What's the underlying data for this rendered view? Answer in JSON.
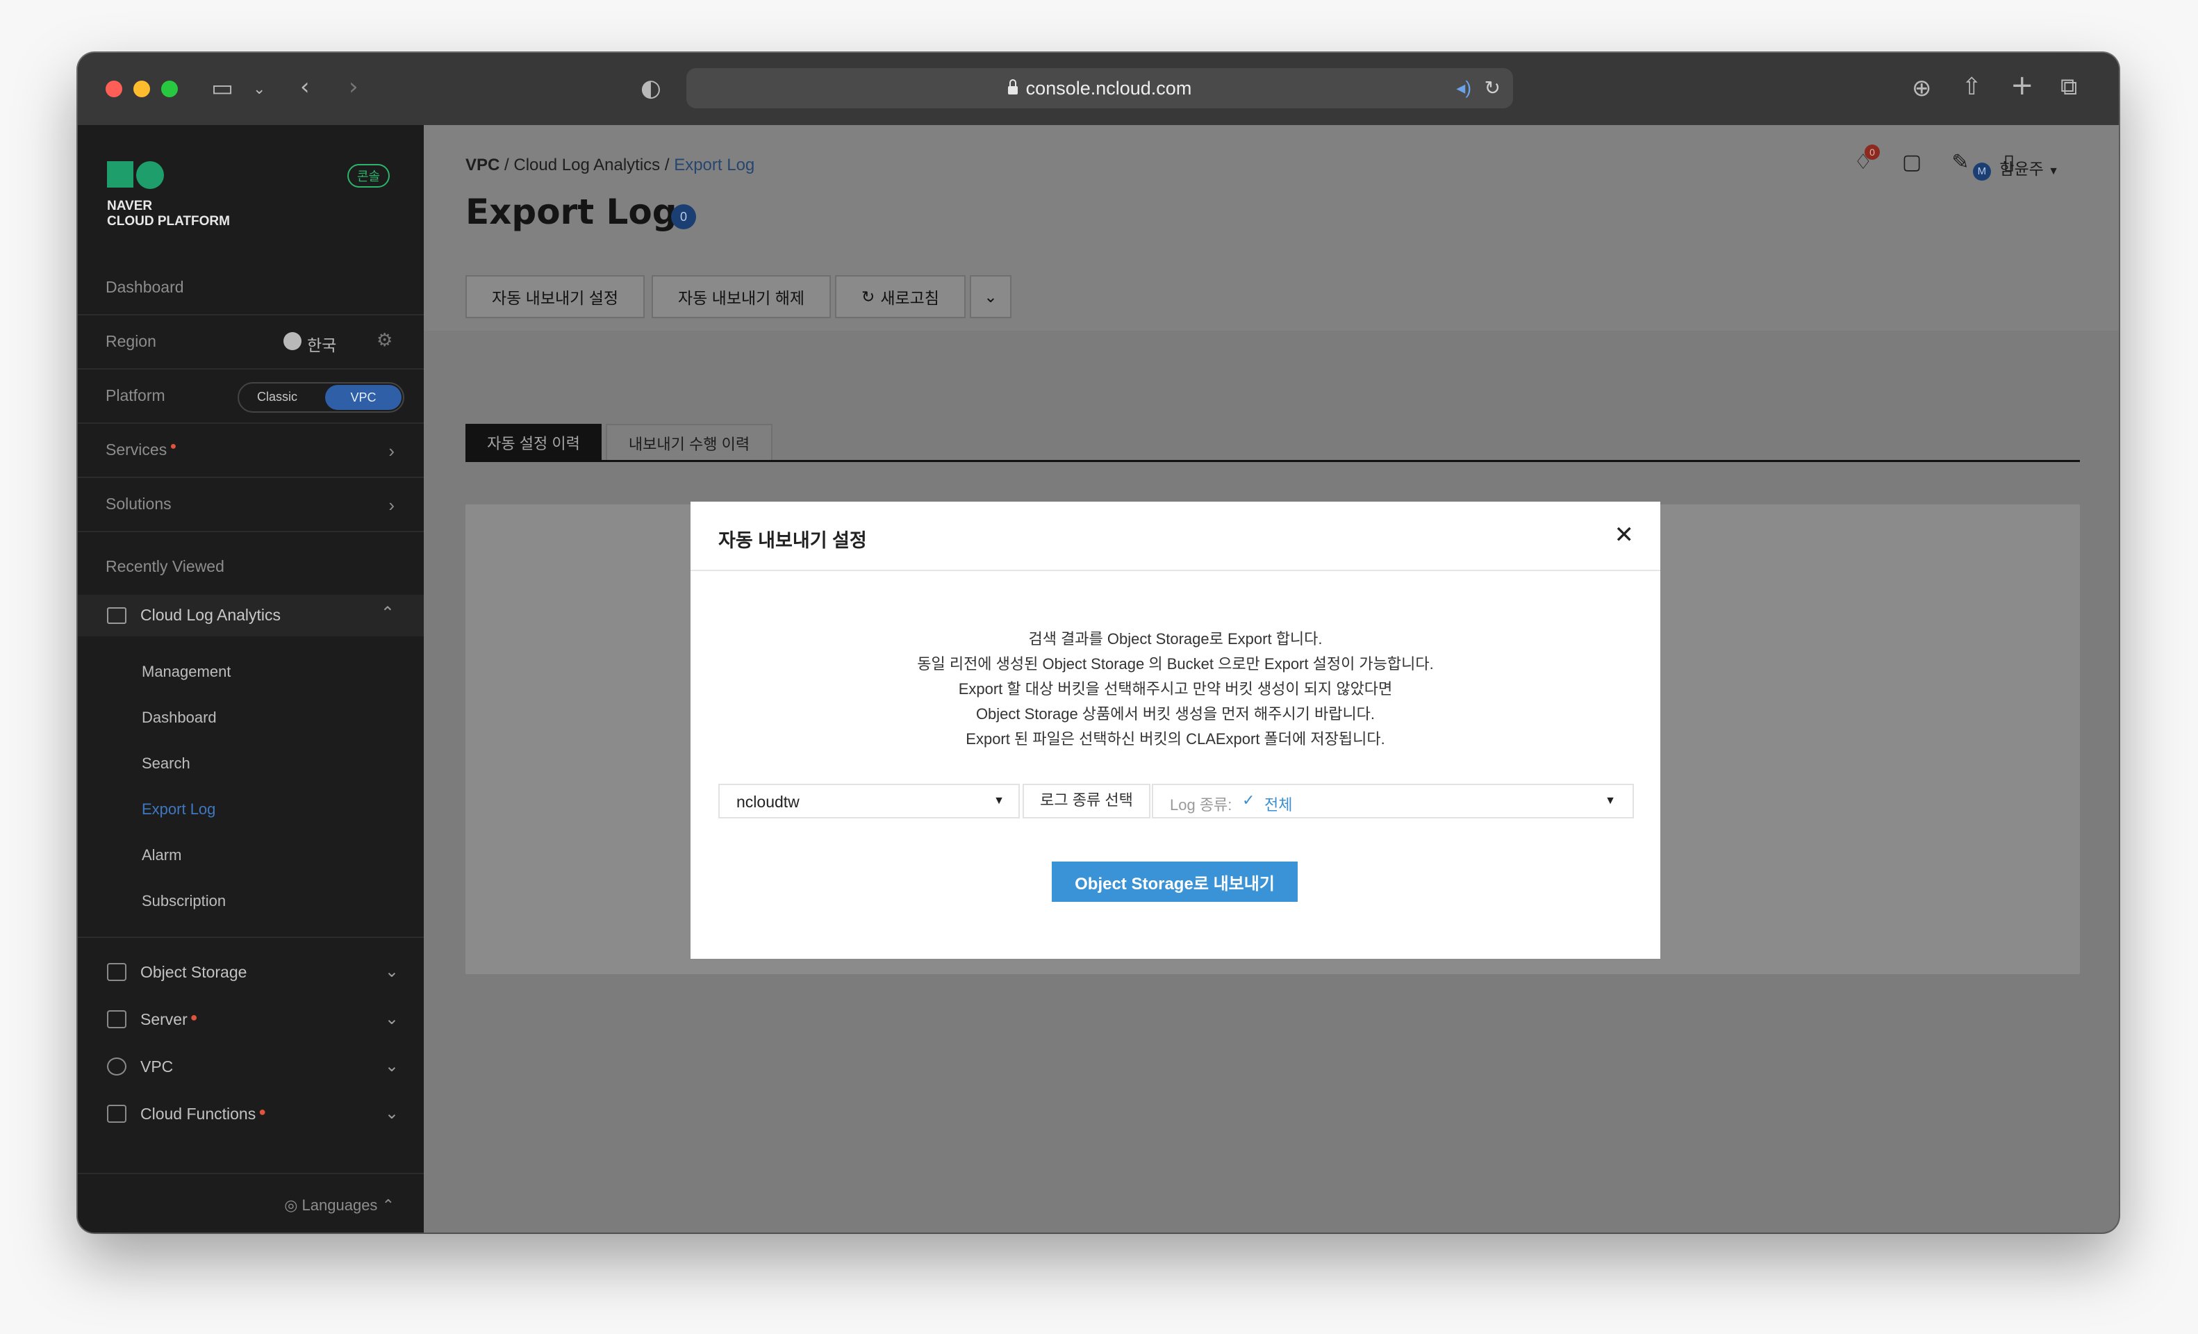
{
  "browser": {
    "url": "console.ncloud.com",
    "icons": [
      "sidebar-icon",
      "chevron-down-icon",
      "back-icon",
      "forward-icon",
      "shield-icon",
      "lock-icon",
      "speaker-icon",
      "reload-icon",
      "download-icon",
      "share-icon",
      "new-tab-icon",
      "tabs-icon"
    ]
  },
  "sidebar": {
    "logo_line1": "NAVER",
    "logo_line2": "CLOUD PLATFORM",
    "console_badge": "콘솔",
    "dashboard": "Dashboard",
    "region_label": "Region",
    "region_value": "한국",
    "platform_label": "Platform",
    "platform_classic": "Classic",
    "platform_vpc": "VPC",
    "services": "Services",
    "solutions": "Solutions",
    "recently_viewed": "Recently Viewed",
    "cla": "Cloud Log Analytics",
    "cla_items": [
      "Management",
      "Dashboard",
      "Search",
      "Export Log",
      "Alarm",
      "Subscription"
    ],
    "services_list": [
      "Object Storage",
      "Server",
      "VPC",
      "Cloud Functions"
    ],
    "languages": "Languages"
  },
  "header": {
    "breadcrumb": [
      "VPC",
      "Cloud Log Analytics",
      "Export Log"
    ],
    "title": "Export Log",
    "title_badge": "0",
    "notification_count": "0",
    "user": "함윤주",
    "user_initial": "M"
  },
  "toolbar": {
    "auto_export_set": "자동 내보내기 설정",
    "auto_export_release": "자동 내보내기 해제",
    "refresh": "새로고침"
  },
  "tabs": [
    "자동 설정 이력",
    "내보내기 수행 이력"
  ],
  "modal": {
    "title": "자동 내보내기 설정",
    "lines": [
      "검색 결과를 Object Storage로 Export 합니다.",
      "동일 리전에 생성된 Object Storage 의 Bucket 으로만 Export 설정이 가능합니다.",
      "Export 할 대상 버킷을 선택해주시고 만약 버킷 생성이 되지 않았다면",
      "Object Storage 상품에서 버킷 생성을 먼저 해주시기 바랍니다.",
      "Export 된 파일은 선택하신 버킷의 CLAExport 폴더에 저장됩니다."
    ],
    "bucket_value": "ncloudtw",
    "log_type_label": "로그 종류 선택",
    "log_type_prefix": "Log 종류:",
    "log_type_value": "전체",
    "submit": "Object Storage로 내보내기"
  },
  "colors": {
    "accent_blue": "#3a93d6",
    "brand_green": "#1e9e6a",
    "sidebar_bg": "#1c1c1c"
  }
}
